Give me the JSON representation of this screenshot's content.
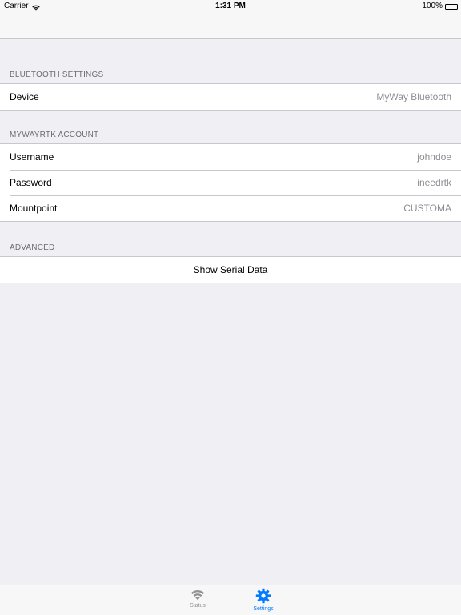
{
  "status_bar": {
    "carrier": "Carrier",
    "time": "1:31 PM",
    "battery": "100%"
  },
  "sections": {
    "bluetooth": {
      "header": "BLUETOOTH SETTINGS",
      "device_label": "Device",
      "device_value": "MyWay Bluetooth"
    },
    "account": {
      "header": "MYWAYRTK ACCOUNT",
      "username_label": "Username",
      "username_value": "johndoe",
      "password_label": "Password",
      "password_value": "ineedrtk",
      "mountpoint_label": "Mountpoint",
      "mountpoint_value": "CUSTOMA"
    },
    "advanced": {
      "header": "ADVANCED",
      "serial_button": "Show Serial Data"
    }
  },
  "tab_bar": {
    "status_label": "Status",
    "settings_label": "Settings",
    "active_color": "#007aff",
    "inactive_color": "#929292",
    "status_icon": "wifi-icon",
    "settings_icon": "gear-icon"
  }
}
